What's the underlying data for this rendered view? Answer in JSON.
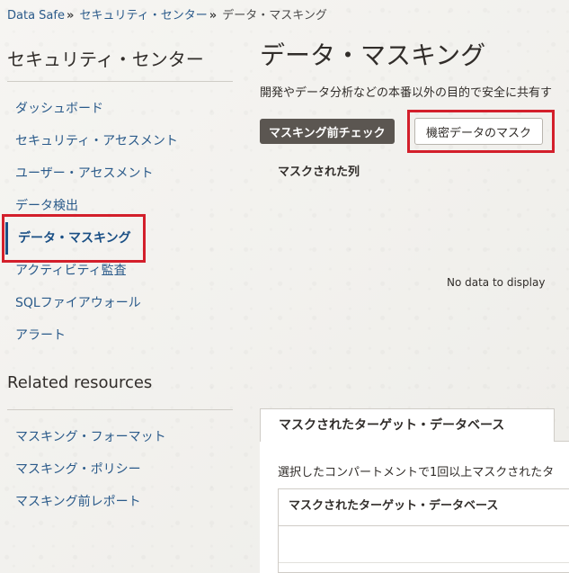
{
  "breadcrumb": {
    "items": [
      "Data Safe",
      "セキュリティ・センター"
    ],
    "separator": "»",
    "current": "データ・マスキング"
  },
  "sidebar": {
    "title": "セキュリティ・センター",
    "items": [
      {
        "label": "ダッシュボード"
      },
      {
        "label": "セキュリティ・アセスメント"
      },
      {
        "label": "ユーザー・アセスメント"
      },
      {
        "label": "データ検出"
      },
      {
        "label": "データ・マスキング",
        "active": true
      },
      {
        "label": "アクティビティ監査"
      },
      {
        "label": "SQLファイアウォール"
      },
      {
        "label": "アラート"
      }
    ]
  },
  "related": {
    "title": "Related resources",
    "items": [
      {
        "label": "マスキング・フォーマット"
      },
      {
        "label": "マスキング・ポリシー"
      },
      {
        "label": "マスキング前レポート"
      }
    ]
  },
  "main": {
    "title": "データ・マスキング",
    "description": "開発やデータ分析などの本番以外の目的で安全に共有す",
    "buttons": {
      "pre_check": "マスキング前チェック",
      "mask_sensitive": "機密データのマスク"
    },
    "masked_columns_label": "マスクされた列",
    "no_data": "No data to display",
    "tab": {
      "label": "マスクされたターゲット・データベース",
      "description": "選択したコンパートメントで1回以上マスクされたタ",
      "table_header": "マスクされたターゲット・データベース"
    }
  },
  "colors": {
    "accent_highlight": "#d31f2b",
    "link": "#2a5a8a",
    "dark_button": "#5b5651"
  }
}
